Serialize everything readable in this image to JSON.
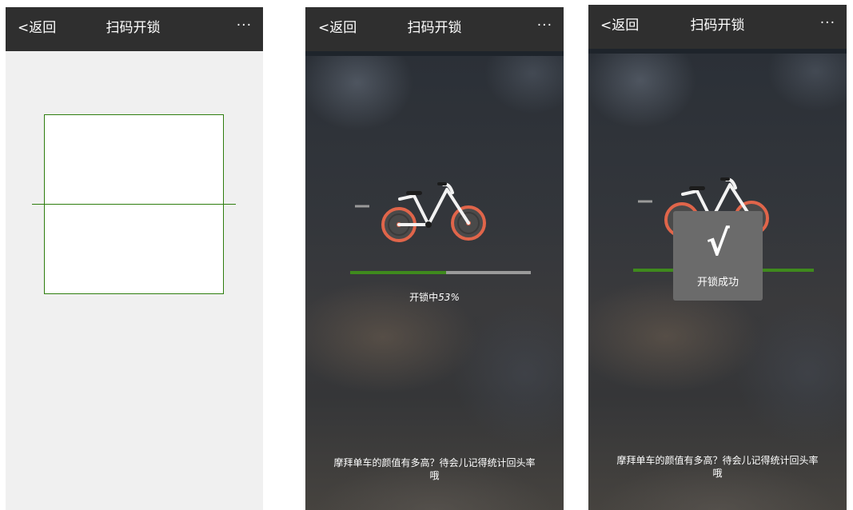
{
  "screens": [
    {
      "nav": {
        "back_label": "<返回",
        "title": "扫码开锁",
        "more_label": "···"
      }
    },
    {
      "nav": {
        "back_label": "<返回",
        "title": "扫码开锁",
        "more_label": "···"
      },
      "progress": {
        "fraction": 0.53,
        "label_prefix": "开锁中",
        "percent_text": "53%"
      },
      "tip": "摩拜单车的颜值有多高？待会儿记得统计回头率哦"
    },
    {
      "nav": {
        "back_label": "<返回",
        "title": "扫码开锁",
        "more_label": "···"
      },
      "progress": {
        "fraction": 1.0
      },
      "toast": {
        "icon": "√",
        "text": "开锁成功"
      },
      "tip": "摩拜单车的颜值有多高？待会儿记得统计回头率哦"
    }
  ],
  "colors": {
    "navbar": "#2f2f2f",
    "accent_green": "#3f8a1d",
    "wheel_orange": "#e0654a",
    "scanner_bg": "#f0f0f0"
  },
  "icons": {
    "bike": "bike-icon",
    "check": "check-icon"
  }
}
